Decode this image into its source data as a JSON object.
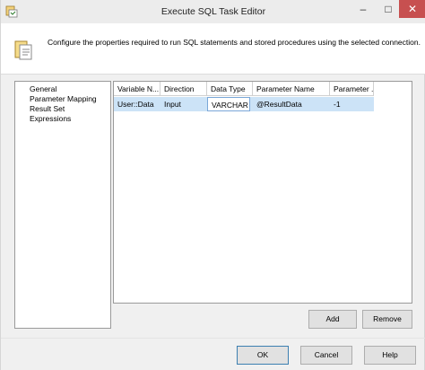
{
  "window": {
    "title": "Execute SQL Task Editor",
    "app_icon": "ssis-task-icon",
    "controls": {
      "minimize": "–",
      "maximize": "□",
      "close": "✕"
    }
  },
  "header": {
    "icon": "properties-icon",
    "text": "Configure the properties required to run SQL statements and stored procedures using the selected connection."
  },
  "nav": {
    "items": [
      {
        "label": "General"
      },
      {
        "label": "Parameter Mapping"
      },
      {
        "label": "Result Set"
      },
      {
        "label": "Expressions"
      }
    ],
    "selected": "Parameter Mapping"
  },
  "grid": {
    "columns": [
      "Variable N...",
      "Direction",
      "Data Type",
      "Parameter Name",
      "Parameter ..."
    ],
    "rows": [
      {
        "variable": "User::Data",
        "direction": "Input",
        "data_type": "VARCHAR",
        "parameter_name": "@ResultData",
        "parameter_size": "-1"
      }
    ]
  },
  "buttons": {
    "add": "Add",
    "remove": "Remove",
    "ok": "OK",
    "cancel": "Cancel",
    "help": "Help"
  },
  "colors": {
    "selection_row": "#cce3f7",
    "close_button": "#c75050"
  }
}
